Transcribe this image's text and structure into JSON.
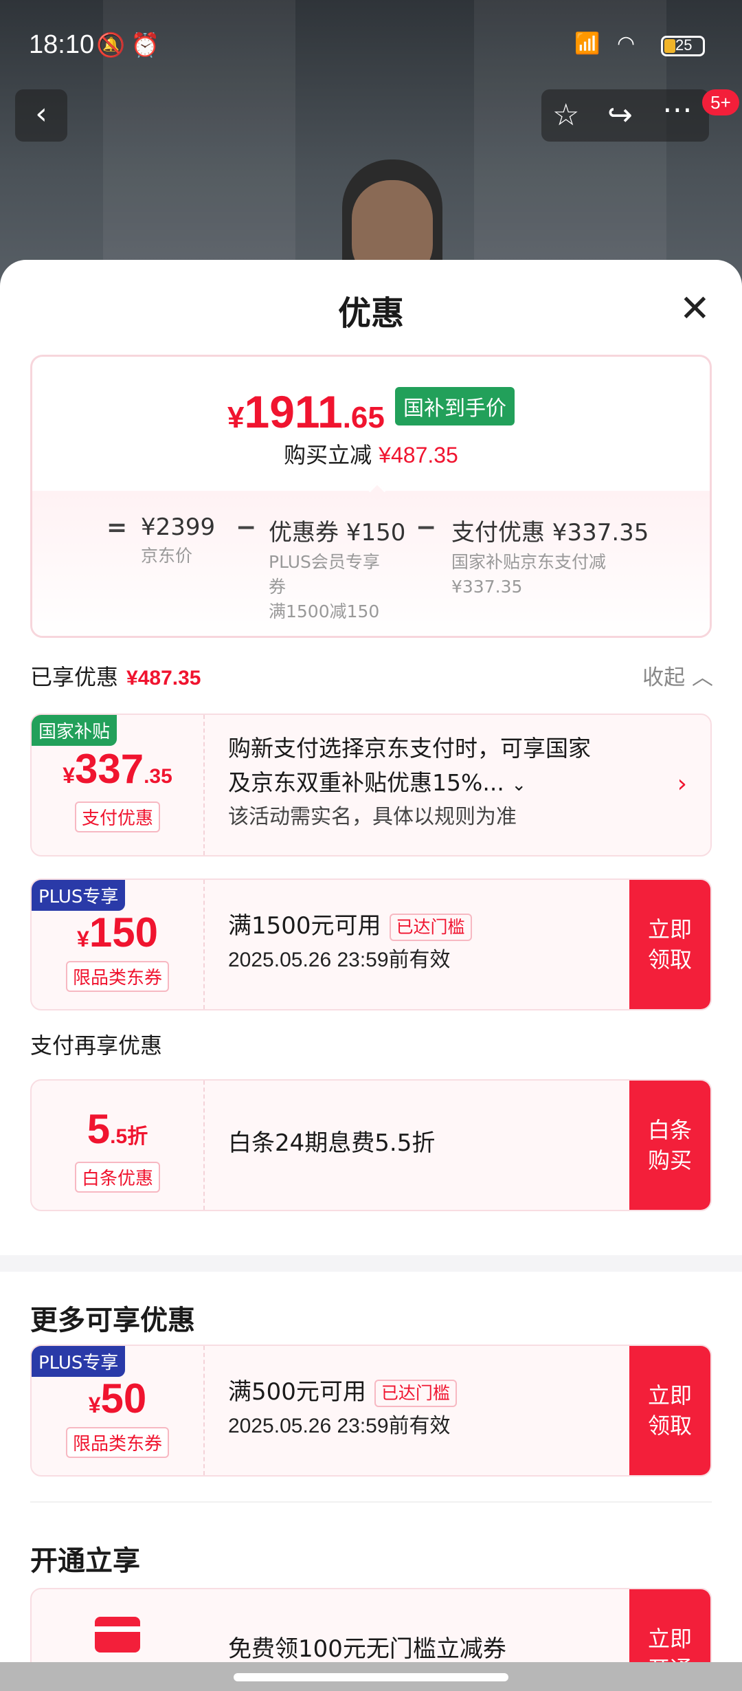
{
  "status_bar": {
    "time": "18:10",
    "battery": "25"
  },
  "header_actions": {
    "badge": "5+"
  },
  "sheet": {
    "title": "优惠"
  },
  "summary": {
    "currency": "¥",
    "price_int": "1911",
    "price_dec": ".65",
    "price_tag": "国补到手价",
    "reduce_label": "购买立减",
    "reduce_value": "¥487.35",
    "calc": {
      "eq": "=",
      "minus": "−",
      "jd_price": "¥2399",
      "jd_price_label": "京东价",
      "coupon_head": "优惠券 ¥150",
      "coupon_sub": [
        "PLUS会员专享",
        "券",
        "满1500减150"
      ],
      "pay_head": "支付优惠 ¥337.35",
      "pay_sub": [
        "国家补贴京东支付减",
        "¥337.35"
      ]
    }
  },
  "enjoyed": {
    "label": "已享优惠",
    "value": "¥487.35",
    "collapse": "收起"
  },
  "cards": {
    "subsidy": {
      "tag": "国家补贴",
      "cur": "¥",
      "big": "337",
      "small": ".35",
      "pill": "支付优惠",
      "line1": "购新支付选择京东支付时，可享国家",
      "line2": "及京东双重补贴优惠15%...",
      "line3": "该活动需实名，具体以规则为准"
    },
    "plus150": {
      "tag": "PLUS专享",
      "cur": "¥",
      "big": "150",
      "pill": "限品类东券",
      "condition": "满1500元可用",
      "reached": "已达门槛",
      "date": "2025.05.26 23:59前有效",
      "btn": "立即领取"
    },
    "baitiao": {
      "big": "5",
      "small": ".5折",
      "pill": "白条优惠",
      "text": "白条24期息费5.5折",
      "btn": "白条购买"
    },
    "plus50": {
      "tag": "PLUS专享",
      "cur": "¥",
      "big": "50",
      "pill": "限品类东券",
      "condition": "满500元可用",
      "reached": "已达门槛",
      "date": "2025.05.26 23:59前有效",
      "btn": "立即领取"
    },
    "open": {
      "text": "免费领100元无门槛立减券",
      "btn": "立即开通"
    }
  },
  "sections": {
    "pay_more": "支付再享优惠",
    "more": "更多可享优惠",
    "open": "开通立享"
  },
  "colors": {
    "accent_red": "#f31f3a",
    "green": "#22a05a",
    "plus_blue": "#2a3aa8"
  }
}
